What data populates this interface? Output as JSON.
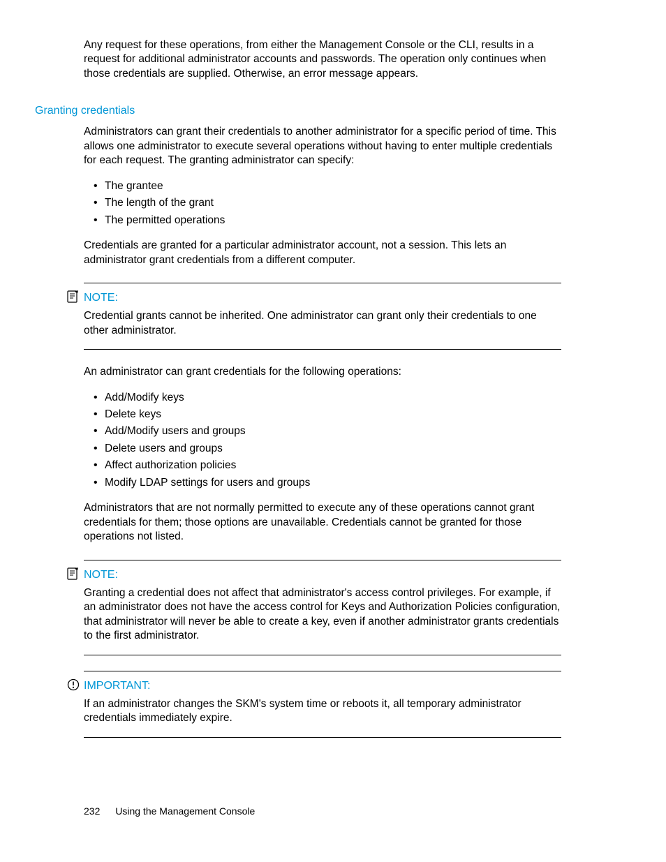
{
  "intro_para": "Any request for these operations, from either the Management Console or the CLI, results in a request for additional administrator accounts and passwords. The operation only continues when those credentials are supplied. Otherwise, an error message appears.",
  "section": {
    "heading": "Granting credentials",
    "para1": "Administrators can grant their credentials to another administrator for a specific period of time. This allows one administrator to execute several operations without having to enter multiple credentials for each request. The granting administrator can specify:",
    "list1": [
      "The grantee",
      "The length of the grant",
      "The permitted operations"
    ],
    "para2": "Credentials are granted for a particular administrator account, not a session. This lets an administrator grant credentials from a different computer."
  },
  "note1": {
    "label": "NOTE:",
    "body": "Credential grants cannot be inherited. One administrator can grant only their credentials to one other administrator."
  },
  "after_note1": {
    "para": "An administrator can grant credentials for the following operations:",
    "list": [
      "Add/Modify keys",
      "Delete keys",
      "Add/Modify users and groups",
      "Delete users and groups",
      "Affect authorization policies",
      "Modify LDAP settings for users and groups"
    ],
    "para2": "Administrators that are not normally permitted to execute any of these operations cannot grant credentials for them; those options are unavailable. Credentials cannot be granted for those operations not listed."
  },
  "note2": {
    "label": "NOTE:",
    "body": "Granting a credential does not affect that administrator's access control privileges. For example, if an administrator does not have the access control for Keys and Authorization Policies configuration, that administrator will never be able to create a key, even if another administrator grants credentials to the first administrator."
  },
  "important": {
    "label": "IMPORTANT:",
    "body": "If an administrator changes the SKM's system time or reboots it, all temporary administrator credentials immediately expire."
  },
  "footer": {
    "page": "232",
    "title": "Using the Management Console"
  }
}
